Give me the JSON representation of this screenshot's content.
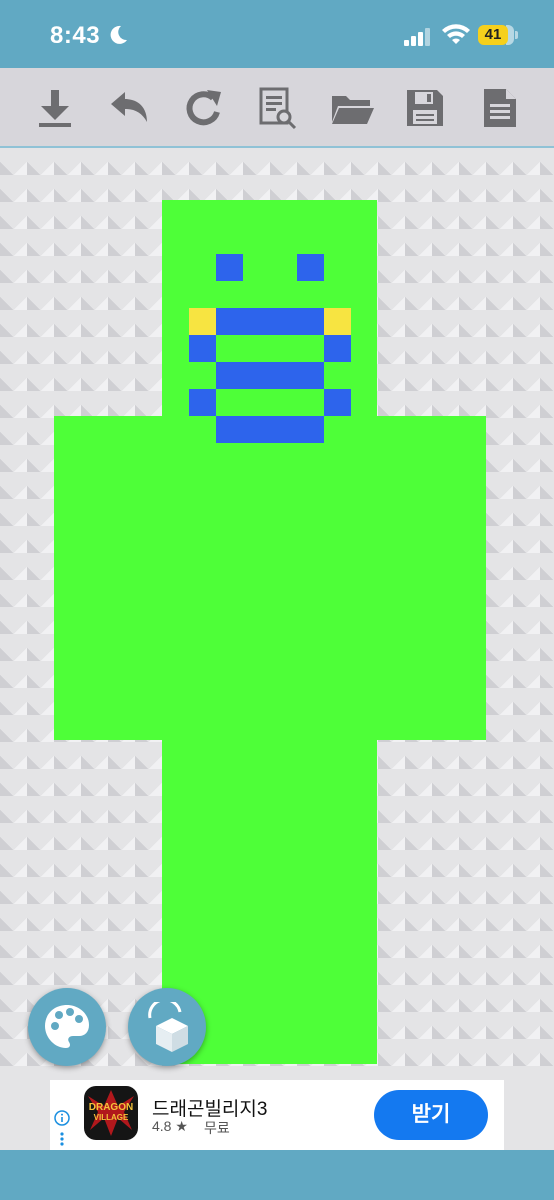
{
  "status_bar": {
    "time": "8:43",
    "battery": "41",
    "icons": [
      "moon-icon",
      "signal-icon",
      "wifi-icon",
      "battery-icon"
    ]
  },
  "toolbar": {
    "tools": [
      {
        "name": "download-icon"
      },
      {
        "name": "undo-icon"
      },
      {
        "name": "redo-icon"
      },
      {
        "name": "preview-icon"
      },
      {
        "name": "folder-icon"
      },
      {
        "name": "save-icon"
      },
      {
        "name": "document-icon"
      }
    ]
  },
  "skin": {
    "colors": {
      "body": "#4eff38",
      "accent": "#2d64ec",
      "highlight": "#f7e441"
    }
  },
  "fabs": [
    {
      "name": "palette-icon"
    },
    {
      "name": "cube-icon"
    }
  ],
  "ad": {
    "title": "드래곤빌리지3",
    "rating": "4.8 ★",
    "price": "무료",
    "button_label": "받기",
    "icon_text": "DRAGON VILLAGE"
  },
  "colors": {
    "primary": "#61a9c3",
    "toolbar": "#d7d6db",
    "ad_button": "#1479f0"
  }
}
